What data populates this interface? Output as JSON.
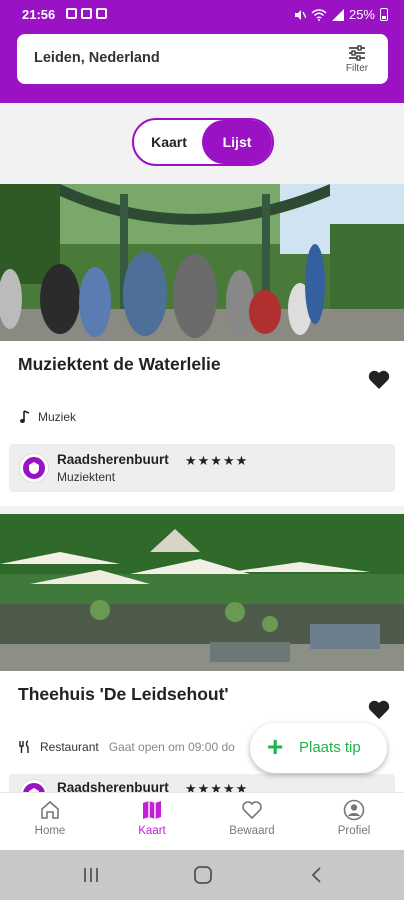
{
  "status": {
    "time": "21:56",
    "battery": "25%"
  },
  "search": {
    "location": "Leiden, Nederland",
    "filter_label": "Filter"
  },
  "toggle": {
    "map_label": "Kaart",
    "list_label": "Lijst",
    "active": "Lijst"
  },
  "cards": [
    {
      "title": "Muziektent de Waterlelie",
      "category": "Muziek",
      "neighborhood": "Raadsherenbuurt",
      "neighborhood_sub": "Muziektent",
      "stars": "★★★★★"
    },
    {
      "title": "Theehuis 'De Leidsehout'",
      "category": "Restaurant",
      "open_text": "Gaat open om 09:00 do",
      "neighborhood": "Raadsherenbuurt",
      "stars": "★★★★★"
    }
  ],
  "fab": {
    "label": "Plaats tip"
  },
  "bottom_nav": [
    {
      "label": "Home"
    },
    {
      "label": "Kaart"
    },
    {
      "label": "Bewaard"
    },
    {
      "label": "Profiel"
    }
  ],
  "colors": {
    "brand": "#9a12c4",
    "accent_green": "#1db44a",
    "active_nav": "#c21fd6"
  }
}
